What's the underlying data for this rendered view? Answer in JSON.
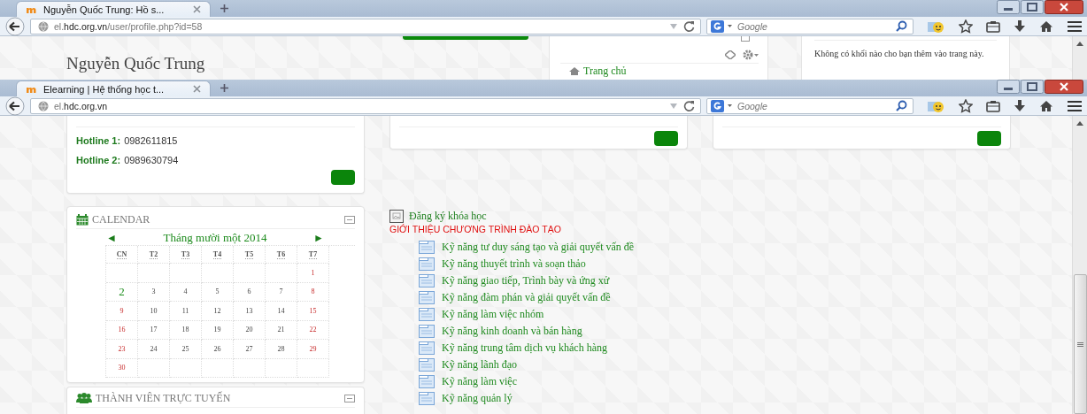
{
  "windows": [
    {
      "tab": {
        "title": "Nguyễn Quốc Trung: Hồ s..."
      },
      "address": "el.**hdc.org.vn**/user/profile.php?id=58",
      "search": {
        "placeholder": "Google"
      },
      "page": {
        "kind": "profile",
        "heading": "Nguyễn Quốc Trung",
        "nav_link": "Trang chủ",
        "notice": "Không có khối nào cho bạn thêm vào trang này."
      }
    },
    {
      "tab": {
        "title": "Elearning | Hệ thống học t..."
      },
      "address": "el.**hdc.org.vn**",
      "search": {
        "placeholder": "Google"
      },
      "page": {
        "kind": "home",
        "hotlines": [
          {
            "label": "Hotline 1:",
            "number": "0982611815"
          },
          {
            "label": "Hotline 2:",
            "number": "0989630794"
          }
        ],
        "calendar": {
          "title": "CALENDAR",
          "prev": "◄",
          "month": "Tháng mười một 2014",
          "next": "►",
          "weekdays": [
            "CN",
            "T2",
            "T3",
            "T4",
            "T5",
            "T6",
            "T7"
          ],
          "days": [
            {
              "kind": "blank"
            },
            {
              "kind": "blank"
            },
            {
              "kind": "blank"
            },
            {
              "kind": "blank"
            },
            {
              "kind": "blank"
            },
            {
              "kind": "blank"
            },
            {
              "kind": "day",
              "day": "1",
              "weekend": true,
              "today": false
            },
            {
              "kind": "day",
              "day": "2",
              "weekend": true,
              "today": true
            },
            {
              "kind": "day",
              "day": "3",
              "weekend": false,
              "today": false
            },
            {
              "kind": "day",
              "day": "4",
              "weekend": false,
              "today": false
            },
            {
              "kind": "day",
              "day": "5",
              "weekend": false,
              "today": false
            },
            {
              "kind": "day",
              "day": "6",
              "weekend": false,
              "today": false
            },
            {
              "kind": "day",
              "day": "7",
              "weekend": false,
              "today": false
            },
            {
              "kind": "day",
              "day": "8",
              "weekend": true,
              "today": false
            },
            {
              "kind": "day",
              "day": "9",
              "weekend": true,
              "today": false
            },
            {
              "kind": "day",
              "day": "10",
              "weekend": false,
              "today": false
            },
            {
              "kind": "day",
              "day": "11",
              "weekend": false,
              "today": false
            },
            {
              "kind": "day",
              "day": "12",
              "weekend": false,
              "today": false
            },
            {
              "kind": "day",
              "day": "13",
              "weekend": false,
              "today": false
            },
            {
              "kind": "day",
              "day": "14",
              "weekend": false,
              "today": false
            },
            {
              "kind": "day",
              "day": "15",
              "weekend": true,
              "today": false
            },
            {
              "kind": "day",
              "day": "16",
              "weekend": true,
              "today": false
            },
            {
              "kind": "day",
              "day": "17",
              "weekend": false,
              "today": false
            },
            {
              "kind": "day",
              "day": "18",
              "weekend": false,
              "today": false
            },
            {
              "kind": "day",
              "day": "19",
              "weekend": false,
              "today": false
            },
            {
              "kind": "day",
              "day": "20",
              "weekend": false,
              "today": false
            },
            {
              "kind": "day",
              "day": "21",
              "weekend": false,
              "today": false
            },
            {
              "kind": "day",
              "day": "22",
              "weekend": true,
              "today": false
            },
            {
              "kind": "day",
              "day": "23",
              "weekend": true,
              "today": false
            },
            {
              "kind": "day",
              "day": "24",
              "weekend": false,
              "today": false
            },
            {
              "kind": "day",
              "day": "25",
              "weekend": false,
              "today": false
            },
            {
              "kind": "day",
              "day": "26",
              "weekend": false,
              "today": false
            },
            {
              "kind": "day",
              "day": "27",
              "weekend": false,
              "today": false
            },
            {
              "kind": "day",
              "day": "28",
              "weekend": false,
              "today": false
            },
            {
              "kind": "day",
              "day": "29",
              "weekend": true,
              "today": false
            },
            {
              "kind": "day",
              "day": "30",
              "weekend": true,
              "today": false
            },
            {
              "kind": "blank"
            },
            {
              "kind": "blank"
            },
            {
              "kind": "blank"
            },
            {
              "kind": "blank"
            },
            {
              "kind": "blank"
            },
            {
              "kind": "blank"
            }
          ]
        },
        "members": {
          "title": "THÀNH VIÊN TRỰC TUYẾN"
        },
        "register_link": "Đăng ký khóa học",
        "program_title": "GIỚI THIỆU CHƯƠNG TRÌNH ĐÀO TẠO",
        "courses": [
          "Kỹ năng tư duy sáng tạo và giải quyết vấn đề",
          "Kỹ năng thuyết trình và soạn thảo",
          "Kỹ năng giao tiếp, Trình bày và ứng xử",
          "Kỹ năng đàm phán và giải quyết vấn đề",
          "Kỹ năng làm việc nhóm",
          "Kỹ năng kinh doanh và bán hàng",
          "Kỹ năng trung tâm dịch vụ khách hàng",
          "Kỹ năng lãnh đạo",
          "Kỹ năng làm việc",
          "Kỹ năng quản lý"
        ]
      }
    }
  ]
}
